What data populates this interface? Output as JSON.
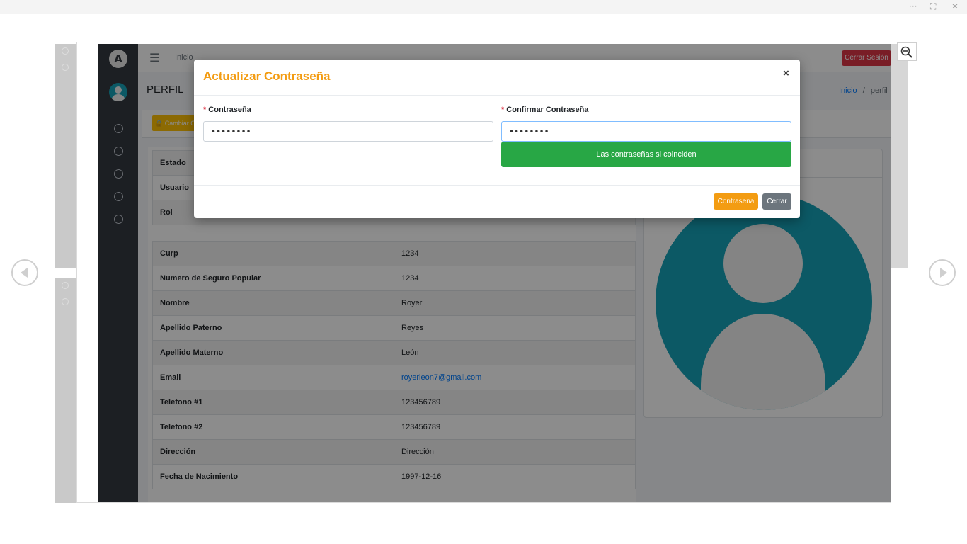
{
  "viewer": {
    "more_glyph": "···",
    "fullscreen_glyph": "⛶",
    "close_glyph": "✕"
  },
  "app": {
    "logo_letter": "A",
    "menu_glyph": "☰",
    "home_link": "Inicio",
    "logout_label": "Cerrar Sesión",
    "page_title": "PERFIL",
    "breadcrumb": {
      "home": "Inicio",
      "separator": "/",
      "current": "perfil"
    },
    "change_password_label": "🔒 Cambiar Contraseña",
    "top_table": [
      {
        "key": "Estado",
        "value": ""
      },
      {
        "key": "Usuario",
        "value": ""
      },
      {
        "key": "Rol",
        "value": ""
      }
    ],
    "details_table": [
      {
        "key": "Curp",
        "value": "1234"
      },
      {
        "key": "Numero de Seguro Popular",
        "value": "1234"
      },
      {
        "key": "Nombre",
        "value": "Royer"
      },
      {
        "key": "Apellido Paterno",
        "value": "Reyes"
      },
      {
        "key": "Apellido Materno",
        "value": "León"
      },
      {
        "key": "Email",
        "value": "royerleon7@gmail.com"
      },
      {
        "key": "Telefono #1",
        "value": "123456789"
      },
      {
        "key": "Telefono #2",
        "value": "123456789"
      },
      {
        "key": "Dirección",
        "value": "Dirección"
      },
      {
        "key": "Fecha de Nacimiento",
        "value": "1997-12-16"
      }
    ]
  },
  "modal": {
    "title": "Actualizar Contraseña",
    "close_glyph": "×",
    "required_mark": "*",
    "password_label": "Contraseña",
    "password_value": "••••••••",
    "confirm_label": "Confirmar Contraseña",
    "confirm_value": "••••••••",
    "match_message": "Las contraseñas si coinciden",
    "save_button": "Contrasena",
    "cancel_button": "Cerrar"
  },
  "colors": {
    "accent": "#f39c12",
    "success": "#28a745",
    "danger": "#dc3545",
    "sidebar": "#343a40",
    "avatar": "#17a2b8"
  }
}
